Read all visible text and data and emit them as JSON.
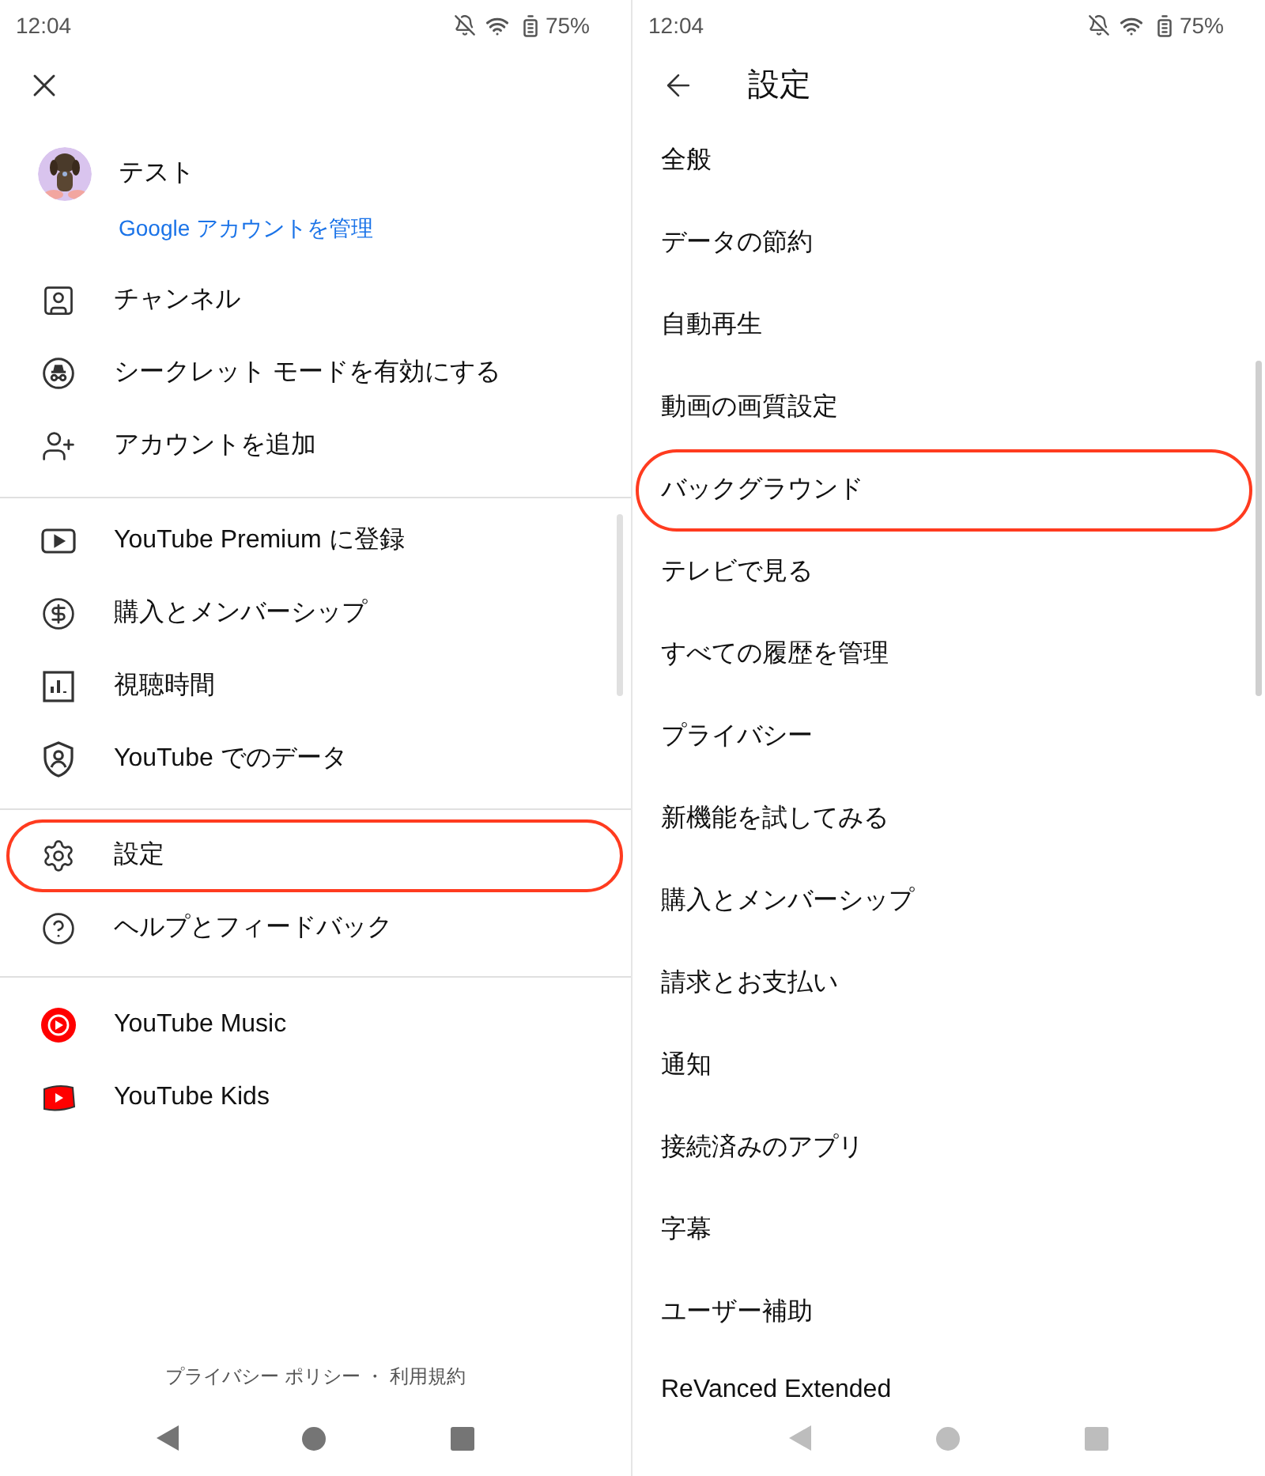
{
  "left_panel": {
    "status_bar": {
      "time": "12:04",
      "battery": "75%"
    },
    "account": {
      "name": "テスト",
      "manage_link": "Google アカウントを管理"
    },
    "menu_sections": [
      {
        "items": [
          {
            "label": "チャンネル",
            "highlighted": false
          },
          {
            "label": "シークレット モードを有効にする",
            "highlighted": false
          },
          {
            "label": "アカウントを追加",
            "highlighted": false
          }
        ]
      },
      {
        "items": [
          {
            "label": "YouTube Premium に登録",
            "highlighted": false
          },
          {
            "label": "購入とメンバーシップ",
            "highlighted": false
          },
          {
            "label": "視聴時間",
            "highlighted": false
          },
          {
            "label": "YouTube でのデータ",
            "highlighted": false
          }
        ]
      },
      {
        "items": [
          {
            "label": "設定",
            "highlighted": true
          },
          {
            "label": "ヘルプとフィードバック",
            "highlighted": false
          }
        ]
      },
      {
        "items": [
          {
            "label": "YouTube Music",
            "highlighted": false
          },
          {
            "label": "YouTube Kids",
            "highlighted": false
          }
        ]
      }
    ],
    "footer": "プライバシー ポリシー ・ 利用規約"
  },
  "right_panel": {
    "status_bar": {
      "time": "12:04",
      "battery": "75%"
    },
    "title": "設定",
    "settings_items": [
      {
        "label": "全般",
        "highlighted": false
      },
      {
        "label": "データの節約",
        "highlighted": false
      },
      {
        "label": "自動再生",
        "highlighted": false
      },
      {
        "label": "動画の画質設定",
        "highlighted": false
      },
      {
        "label": "バックグラウンド",
        "highlighted": true
      },
      {
        "label": "テレビで見る",
        "highlighted": false
      },
      {
        "label": "すべての履歴を管理",
        "highlighted": false
      },
      {
        "label": "プライバシー",
        "highlighted": false
      },
      {
        "label": "新機能を試してみる",
        "highlighted": false
      },
      {
        "label": "購入とメンバーシップ",
        "highlighted": false
      },
      {
        "label": "請求とお支払い",
        "highlighted": false
      },
      {
        "label": "通知",
        "highlighted": false
      },
      {
        "label": "接続済みのアプリ",
        "highlighted": false
      },
      {
        "label": "字幕",
        "highlighted": false
      },
      {
        "label": "ユーザー補助",
        "highlighted": false
      },
      {
        "label": "ReVanced Extended",
        "highlighted": false
      }
    ]
  }
}
